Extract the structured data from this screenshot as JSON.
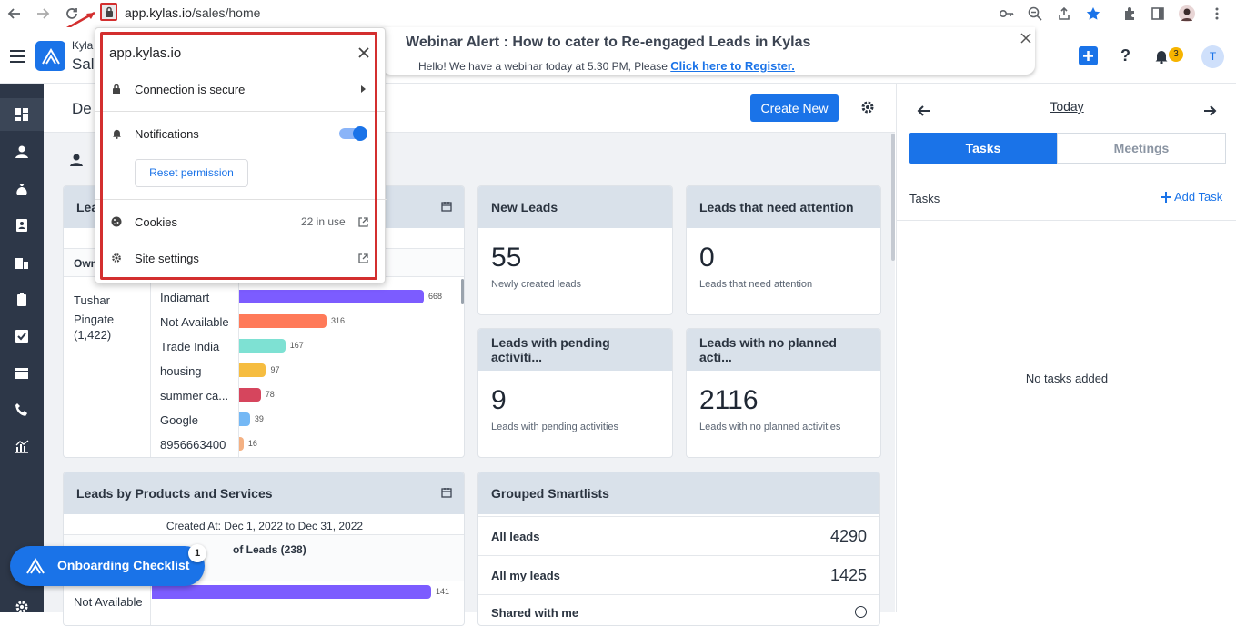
{
  "browser": {
    "url_host": "app.kylas.io",
    "url_path": "/sales/home"
  },
  "app": {
    "brand_line1": "Kyla",
    "brand_line2": "Sal",
    "notification_count": "3",
    "avatar_letter": "T",
    "help_label": "?"
  },
  "webinar": {
    "title": "Webinar Alert : How to cater to Re-engaged Leads in Kylas",
    "text": "Hello! We have a webinar today at 5.30 PM, Please",
    "link": "Click here to Register."
  },
  "popup": {
    "site": "app.kylas.io",
    "connection": "Connection is secure",
    "notifications": "Notifications",
    "reset": "Reset permission",
    "cookies": "Cookies",
    "cookies_count": "22 in use",
    "site_settings": "Site settings"
  },
  "dashboard": {
    "title_partial": "De",
    "create_new": "Create New",
    "lead_card_title_partial": "Lea",
    "owner_header_partial": "Own",
    "owner_name": "Tushar Pingate",
    "owner_count": "(1,422)",
    "bars": [
      {
        "label": "Indiamart",
        "value": 668,
        "color": "#7c5cff"
      },
      {
        "label": "Not Available",
        "value": 316,
        "color": "#ff7a59"
      },
      {
        "label": "Trade India",
        "value": 167,
        "color": "#7ee1d3"
      },
      {
        "label": "housing",
        "value": 97,
        "color": "#f6bd40"
      },
      {
        "label": "summer ca...",
        "value": 78,
        "color": "#d6455d"
      },
      {
        "label": "Google",
        "value": 39,
        "color": "#74b8f5"
      },
      {
        "label": "8956663400",
        "value": 16,
        "color": "#f4b183"
      }
    ],
    "new_leads": {
      "title": "New Leads",
      "value": "55",
      "sub": "Newly created leads"
    },
    "attention": {
      "title": "Leads that need attention",
      "value": "0",
      "sub": "Leads that need attention"
    },
    "pending": {
      "title": "Leads with pending activiti...",
      "value": "9",
      "sub": "Leads with pending activities"
    },
    "no_planned": {
      "title": "Leads with no planned acti...",
      "value": "2116",
      "sub": "Leads with no planned activities"
    },
    "products": {
      "title": "Leads by Products and Services",
      "created": "Created At: Dec 1, 2022 to Dec 31, 2022",
      "col_partial": "of Leads (238)",
      "row_label": "Not Available",
      "row_value": 141,
      "row_color": "#7c5cff"
    },
    "smartlists": {
      "title": "Grouped Smartlists",
      "rows": [
        {
          "label": "All leads",
          "value": "4290"
        },
        {
          "label": "All my leads",
          "value": "1425"
        },
        {
          "label": "Shared with me",
          "value": ""
        }
      ]
    },
    "onboarding": {
      "label": "Onboarding Checklist",
      "badge": "1"
    }
  },
  "right_panel": {
    "day": "Today",
    "tab_tasks": "Tasks",
    "tab_meetings": "Meetings",
    "tasks_label": "Tasks",
    "add_task": "Add Task",
    "empty": "No tasks added"
  }
}
